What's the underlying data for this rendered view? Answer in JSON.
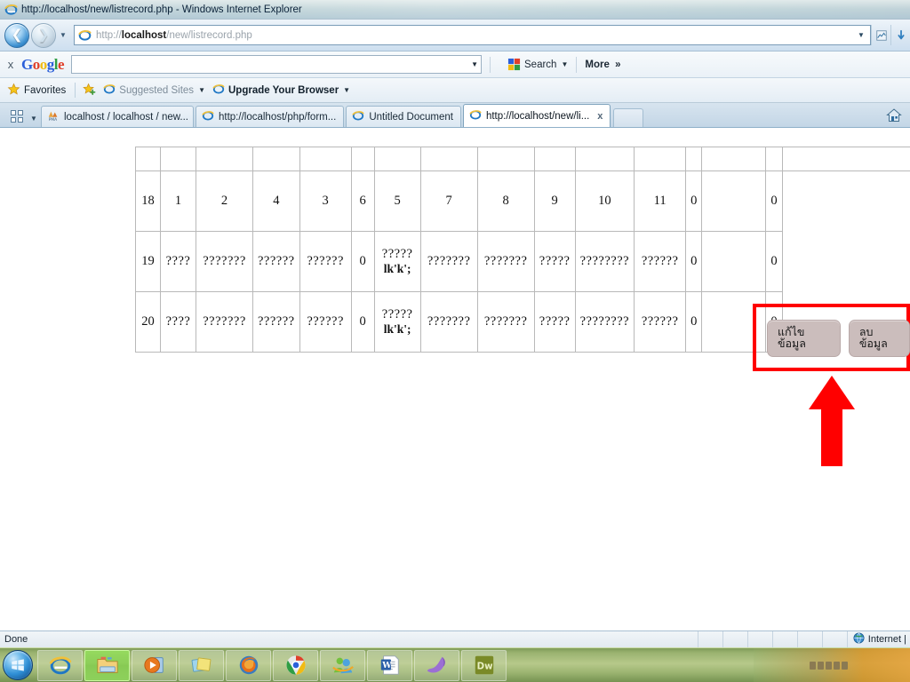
{
  "window": {
    "title": "http://localhost/new/listrecord.php - Windows Internet Explorer",
    "icon": "ie-icon"
  },
  "navigation": {
    "back_icon": "back-arrow-icon",
    "forward_icon": "forward-arrow-icon",
    "recent_pages_icon": "chevron-down-icon",
    "address": {
      "icon": "ie-icon",
      "scheme": "http://",
      "host": "localhost",
      "path": "/new/listrecord.php",
      "full": "http://localhost/new/listrecord.php",
      "dropdown_icon": "chevron-down-icon"
    },
    "compatibility_icon": "compatibility-view-icon",
    "refresh_icon": "refresh-icon"
  },
  "google_toolbar": {
    "close_label": "x",
    "logo": "Google",
    "logo_letters": [
      "G",
      "o",
      "o",
      "g",
      "l",
      "e"
    ],
    "search_input_value": "",
    "search_input_placeholder": "",
    "search_dropdown_icon": "chevron-down-icon",
    "search_button_label": "Search",
    "search_button_icon": "google-square-icon",
    "search_caret_icon": "chevron-down-icon",
    "more_label": "More",
    "more_icon": "double-chevron-right-icon"
  },
  "favorites_bar": {
    "favorites_label": "Favorites",
    "favorites_icon": "star-icon",
    "add_icon": "add-favorite-icon",
    "items": [
      {
        "label": "Suggested Sites",
        "icon": "ie-icon",
        "caret": "chevron-down-icon"
      },
      {
        "label": "Upgrade Your Browser",
        "icon": "ie-icon",
        "caret": "chevron-down-icon",
        "bold": true
      }
    ]
  },
  "tabs": {
    "quick_tabs_icon": "quick-tabs-icon",
    "tab_list_caret": "chevron-down-icon",
    "items": [
      {
        "label": "localhost / localhost / new...",
        "icon": "phpmyadmin-icon",
        "active": false
      },
      {
        "label": "http://localhost/php/form...",
        "icon": "ie-icon",
        "active": false
      },
      {
        "label": "Untitled Document",
        "icon": "ie-icon",
        "active": false
      },
      {
        "label": "http://localhost/new/li...",
        "icon": "ie-icon",
        "active": true,
        "close_label": "x"
      }
    ],
    "new_tab_label": "",
    "home_icon": "home-icon"
  },
  "table": {
    "header_cells_count": 15,
    "rows": [
      {
        "id": "18",
        "cells": [
          "18",
          "1",
          "2",
          "4",
          "3",
          "6",
          "5",
          "7",
          "8",
          "9",
          "10",
          "11",
          "0",
          "",
          "0"
        ],
        "has_actions": true
      },
      {
        "id": "19",
        "cells": [
          "19",
          "????",
          "???????",
          "??????",
          "??????",
          "0",
          "?????",
          "???????",
          "???????",
          "?????",
          "????????",
          "??????",
          "0",
          "",
          "0"
        ],
        "special_cell_index": 6,
        "special_cell_line2": "lk'k';",
        "has_actions": false
      },
      {
        "id": "20",
        "cells": [
          "20",
          "????",
          "???????",
          "??????",
          "??????",
          "0",
          "?????",
          "???????",
          "???????",
          "?????",
          "????????",
          "??????",
          "0",
          "",
          "0"
        ],
        "special_cell_index": 6,
        "special_cell_line2": "lk'k';",
        "has_actions": false
      }
    ]
  },
  "actions": {
    "edit_label": "แก้ไขข้อมูล",
    "delete_label": "ลบข้อมูล",
    "button_color": "#cbbdbc"
  },
  "annotations": {
    "highlight_box_color": "#ff0000",
    "arrow_color": "#ff0000",
    "arrow_direction": "up"
  },
  "status_bar": {
    "text": "Done",
    "zone_label": "Internet |",
    "zone_icon": "globe-icon"
  },
  "taskbar": {
    "start_icon": "windows-start-orb",
    "items": [
      {
        "name": "internet-explorer",
        "icon": "ie-icon",
        "active": false
      },
      {
        "name": "windows-explorer",
        "icon": "folder-icon",
        "active": true
      },
      {
        "name": "windows-media-player",
        "icon": "media-player-icon",
        "active": false
      },
      {
        "name": "sticky-notes",
        "icon": "sticky-notes-icon",
        "active": false
      },
      {
        "name": "firefox",
        "icon": "firefox-icon",
        "active": false
      },
      {
        "name": "google-chrome",
        "icon": "chrome-icon",
        "active": false
      },
      {
        "name": "messenger",
        "icon": "messenger-icon",
        "active": false
      },
      {
        "name": "microsoft-word",
        "icon": "word-icon",
        "active": false
      },
      {
        "name": "sqlyog",
        "icon": "dolphin-icon",
        "active": false
      },
      {
        "name": "dreamweaver",
        "icon": "dreamweaver-icon",
        "label": "Dw",
        "active": false
      }
    ]
  }
}
